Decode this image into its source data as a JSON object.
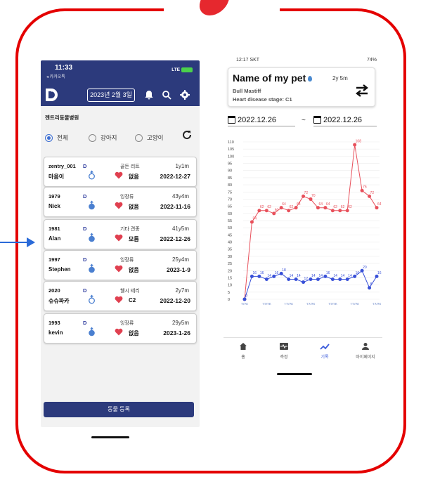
{
  "left": {
    "status": {
      "time": "11:33",
      "carrier": "◂ 카카오톡",
      "signal": "LTE"
    },
    "date": "2023년 2월 3일",
    "hospital": "젠트리동물병원",
    "filters": [
      "전체",
      "강아지",
      "고양이"
    ],
    "cards": [
      {
        "id": "zentry_001",
        "d": "D",
        "name": "마음이",
        "breed": "골든 리트",
        "age": "1y1m",
        "stage": "없음",
        "date": "2022-12-27",
        "gender": "male"
      },
      {
        "id": "1979",
        "d": "D",
        "name": "Nick",
        "breed": "잉장류",
        "age": "43y4m",
        "stage": "없음",
        "date": "2022-11-16",
        "gender": "male-filled"
      },
      {
        "id": "1981",
        "d": "D",
        "name": "Alan",
        "breed": "기타 견종",
        "age": "41y5m",
        "stage": "모름",
        "date": "2022-12-26",
        "gender": "male-filled"
      },
      {
        "id": "1997",
        "d": "D",
        "name": "Stephen",
        "breed": "잉장류",
        "age": "25y4m",
        "stage": "없음",
        "date": "2023-1-9",
        "gender": "male-filled"
      },
      {
        "id": "2020",
        "d": "D",
        "name": "슈슈파카",
        "breed": "웰시 테리",
        "age": "2y7m",
        "stage": "C2",
        "date": "2022-12-20",
        "gender": "male"
      },
      {
        "id": "1993",
        "d": "D",
        "name": "kevin",
        "breed": "잉장류",
        "age": "29y5m",
        "stage": "없음",
        "date": "2023-1-26",
        "gender": "male-filled"
      }
    ],
    "register_label": "동물 등록"
  },
  "right": {
    "status": {
      "time": "12:17 SKT",
      "battery": "74%"
    },
    "pet": {
      "name": "Name of my pet",
      "age": "2y 5m",
      "breed": "Bull Mastiff",
      "stage": "Heart disease stage: C1"
    },
    "date_from": "2022.12.26",
    "date_sep": "~",
    "date_to": "2022.12.26",
    "nav": [
      "홈",
      "측정",
      "기록",
      "마이페이지"
    ]
  },
  "chart_data": {
    "type": "line",
    "ylim": [
      0,
      110
    ],
    "yticks": [
      0,
      5,
      10,
      15,
      20,
      25,
      30,
      35,
      40,
      45,
      50,
      55,
      60,
      65,
      70,
      75,
      80,
      85,
      90,
      95,
      100,
      105,
      110
    ],
    "xtick_labels": [
      "2/26 3:00",
      "12/26 00:40",
      "12/26 01:40",
      "12/26 02:40",
      "12/26 03:40",
      "12/26 04:40",
      "12/26 05:40"
    ],
    "series": [
      {
        "values": [
          0,
          54,
          62,
          62,
          60,
          64,
          62,
          64,
          72,
          70,
          64,
          64,
          62,
          62,
          62,
          108,
          76,
          72,
          64
        ],
        "color": "#e8505b"
      },
      {
        "values": [
          0,
          16,
          16,
          14,
          16,
          18,
          14,
          14,
          12,
          14,
          14,
          16,
          14,
          14,
          14,
          16,
          20,
          8,
          16
        ],
        "color": "#3850d8"
      }
    ]
  }
}
